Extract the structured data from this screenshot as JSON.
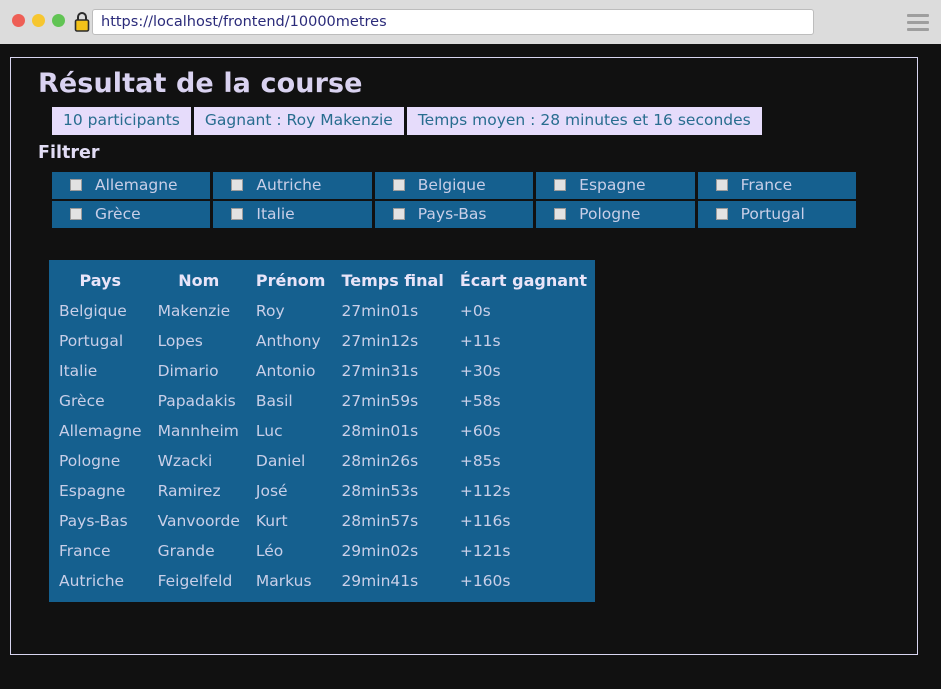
{
  "browser": {
    "url": "https://localhost/frontend/10000metres",
    "lock_icon": "lock-icon",
    "menu_icon": "hamburger-menu-icon",
    "traffic_lights": [
      "close-red",
      "minimize-yellow",
      "maximize-green"
    ]
  },
  "page": {
    "title": "Résultat de la course",
    "filter_heading": "Filtrer",
    "info_badges": [
      "10 participants",
      "Gagnant : Roy Makenzie",
      "Temps moyen : 28 minutes et 16 secondes"
    ]
  },
  "filters": {
    "rows": [
      [
        "Allemagne",
        "Autriche",
        "Belgique",
        "Espagne",
        "France"
      ],
      [
        "Grèce",
        "Italie",
        "Pays-Bas",
        "Pologne",
        "Portugal"
      ]
    ],
    "checked": false
  },
  "results": {
    "columns": [
      "Pays",
      "Nom",
      "Prénom",
      "Temps final",
      "Écart gagnant"
    ],
    "rows": [
      [
        "Belgique",
        "Makenzie",
        "Roy",
        "27min01s",
        "+0s"
      ],
      [
        "Portugal",
        "Lopes",
        "Anthony",
        "27min12s",
        "+11s"
      ],
      [
        "Italie",
        "Dimario",
        "Antonio",
        "27min31s",
        "+30s"
      ],
      [
        "Grèce",
        "Papadakis",
        "Basil",
        "27min59s",
        "+58s"
      ],
      [
        "Allemagne",
        "Mannheim",
        "Luc",
        "28min01s",
        "+60s"
      ],
      [
        "Pologne",
        "Wzacki",
        "Daniel",
        "28min26s",
        "+85s"
      ],
      [
        "Espagne",
        "Ramirez",
        "José",
        "28min53s",
        "+112s"
      ],
      [
        "Pays-Bas",
        "Vanvoorde",
        "Kurt",
        "28min57s",
        "+116s"
      ],
      [
        "France",
        "Grande",
        "Léo",
        "29min02s",
        "+121s"
      ],
      [
        "Autriche",
        "Feigelfeld",
        "Markus",
        "29min41s",
        "+160s"
      ]
    ]
  },
  "colors": {
    "page_background": "#111111",
    "panel_blue": "#15608f",
    "badge_background": "#e6dcfb",
    "badge_text": "#286d8f",
    "heading_text": "#d9d2f0",
    "body_text": "#c9cfe8",
    "chrome_background": "#dcdcdc",
    "url_text": "#2b2b7a"
  }
}
